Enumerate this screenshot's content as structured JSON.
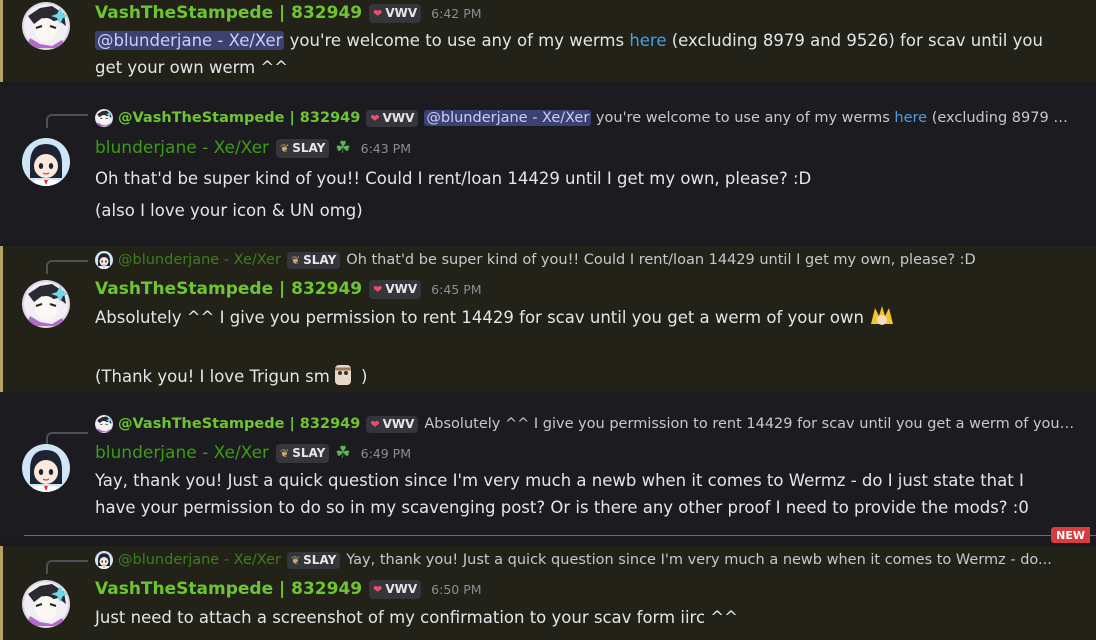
{
  "messages": [
    {
      "author": "VashTheStampede | 832949",
      "tag": "VWV",
      "time": "6:42 PM",
      "mention": "@blunderjane - Xe/Xer",
      "line1_a": " you're welcome to use any of my werms ",
      "link": "here",
      "line1_b": " (excluding 8979 and 9526) for scav until you",
      "line2": "get your own werm ^^"
    },
    {
      "reply_author": "@VashTheStampede | 832949",
      "reply_tag": "VWV",
      "reply_mention": "@blunderjane - Xe/Xer",
      "reply_text_a": " you're welcome to use any of my werms ",
      "reply_link": "here",
      "reply_text_b": " (excluding 8979 a...",
      "author": "blunderjane - Xe/Xer",
      "tag": "SLAY",
      "time": "6:43 PM",
      "line1": "Oh that'd be super kind of you!! Could I rent/loan 14429 until I get my own, please? :D",
      "line2": "(also I love your icon & UN omg)"
    },
    {
      "reply_author": "@blunderjane - Xe/Xer",
      "reply_tag": "SLAY",
      "reply_text": "Oh that'd be super kind of you!! Could I rent/loan 14429 until I get my own, please? :D",
      "author": "VashTheStampede | 832949",
      "tag": "VWV",
      "time": "6:45 PM",
      "line1": "Absolutely ^^ I give you permission to rent 14429 for scav until you get a werm of your own",
      "line2": "(Thank you! I love Trigun sm",
      "line2_end": " )"
    },
    {
      "reply_author": "@VashTheStampede | 832949",
      "reply_tag": "VWV",
      "reply_text": "Absolutely ^^ I give you permission to rent 14429 for scav until you get a werm of your o...",
      "author": "blunderjane - Xe/Xer",
      "tag": "SLAY",
      "time": "6:49 PM",
      "line1": "Yay, thank you! Just a quick question since I'm very much a newb when it comes to Wermz - do I just state that I",
      "line2": "have your permission to do so in my scavenging post? Or is there any other proof I need to provide the mods? :0"
    },
    {
      "reply_author": "@blunderjane - Xe/Xer",
      "reply_tag": "SLAY",
      "reply_text": "Yay, thank you! Just a quick question since I'm very much a newb when it comes to Wermz - do...",
      "author": "VashTheStampede | 832949",
      "tag": "VWV",
      "time": "6:50 PM",
      "line1": "Just need to attach a screenshot of my confirmation to your scav form iirc ^^"
    }
  ],
  "new_badge": "NEW",
  "colors": {
    "vash_name": "#6ec531",
    "jane_name": "#3d9b16",
    "mention_bg": "#3c4270",
    "link": "#4a9ee8",
    "new_marker": "#d83c3e"
  },
  "icons": [
    "heart-icon",
    "leaf-icon",
    "clover-icon",
    "vash-avatar",
    "jane-avatar"
  ]
}
